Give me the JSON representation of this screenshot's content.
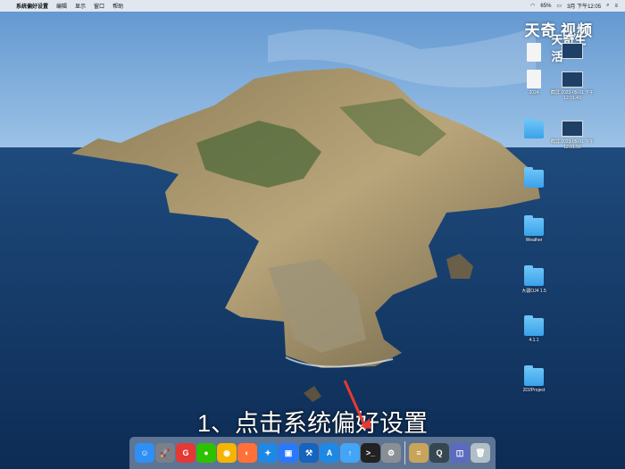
{
  "menubar": {
    "apple_glyph": "",
    "items": [
      "系统偏好设置",
      "编辑",
      "显示",
      "窗口",
      "帮助"
    ],
    "battery": "65%",
    "clock": "3月 下午12:05"
  },
  "watermark": {
    "line1": "天奇",
    "line2": "视频",
    "line3": "天奇生活"
  },
  "desktop_icons": [
    {
      "label": "",
      "kind": "doc"
    },
    {
      "label": "",
      "kind": "shot"
    },
    {
      "label": "2024",
      "kind": "doc"
    },
    {
      "label": "截屏 2023-05-01 下午12.01.43",
      "kind": "shot"
    },
    {
      "label": "",
      "kind": "folder"
    },
    {
      "label": "截屏 2023-05-01 下午12.01.56",
      "kind": "shot"
    },
    {
      "label": "",
      "kind": "folder"
    },
    {
      "label": "Weather",
      "kind": "folder"
    },
    {
      "label": "大疆OJ4 1.5",
      "kind": "folder"
    },
    {
      "label": "4.1.1",
      "kind": "folder"
    },
    {
      "label": "2D2Project",
      "kind": "folder"
    }
  ],
  "caption": "1、点击系统偏好设置",
  "dock": {
    "apps": [
      {
        "name": "finder",
        "glyph": "☺",
        "color": "#2f8ff5"
      },
      {
        "name": "launchpad",
        "glyph": "🚀",
        "color": "#7a7f88"
      },
      {
        "name": "weiyun",
        "glyph": "G",
        "color": "#e53935"
      },
      {
        "name": "wechat",
        "glyph": "●",
        "color": "#2dc100"
      },
      {
        "name": "chrome",
        "glyph": "◉",
        "color": "#f4b400"
      },
      {
        "name": "firefox",
        "glyph": "◐",
        "color": "#ff7139"
      },
      {
        "name": "safari",
        "glyph": "✦",
        "color": "#1e88e5"
      },
      {
        "name": "finder-window",
        "glyph": "▣",
        "color": "#2979ff"
      },
      {
        "name": "xcode",
        "glyph": "⚒",
        "color": "#1565c0"
      },
      {
        "name": "app-store",
        "glyph": "A",
        "color": "#1e88e5"
      },
      {
        "name": "software-update",
        "glyph": "↑",
        "color": "#42a5f5"
      },
      {
        "name": "terminal",
        "glyph": ">_",
        "color": "#222"
      },
      {
        "name": "system-preferences",
        "glyph": "⚙",
        "color": "#8a8f96"
      },
      {
        "name": "notes",
        "glyph": "≡",
        "color": "#c8a45a"
      },
      {
        "name": "quicktime",
        "glyph": "Q",
        "color": "#37474f"
      },
      {
        "name": "preview",
        "glyph": "◫",
        "color": "#5c6bc0"
      },
      {
        "name": "trash",
        "glyph": "🗑",
        "color": "#b0bec5"
      }
    ]
  }
}
